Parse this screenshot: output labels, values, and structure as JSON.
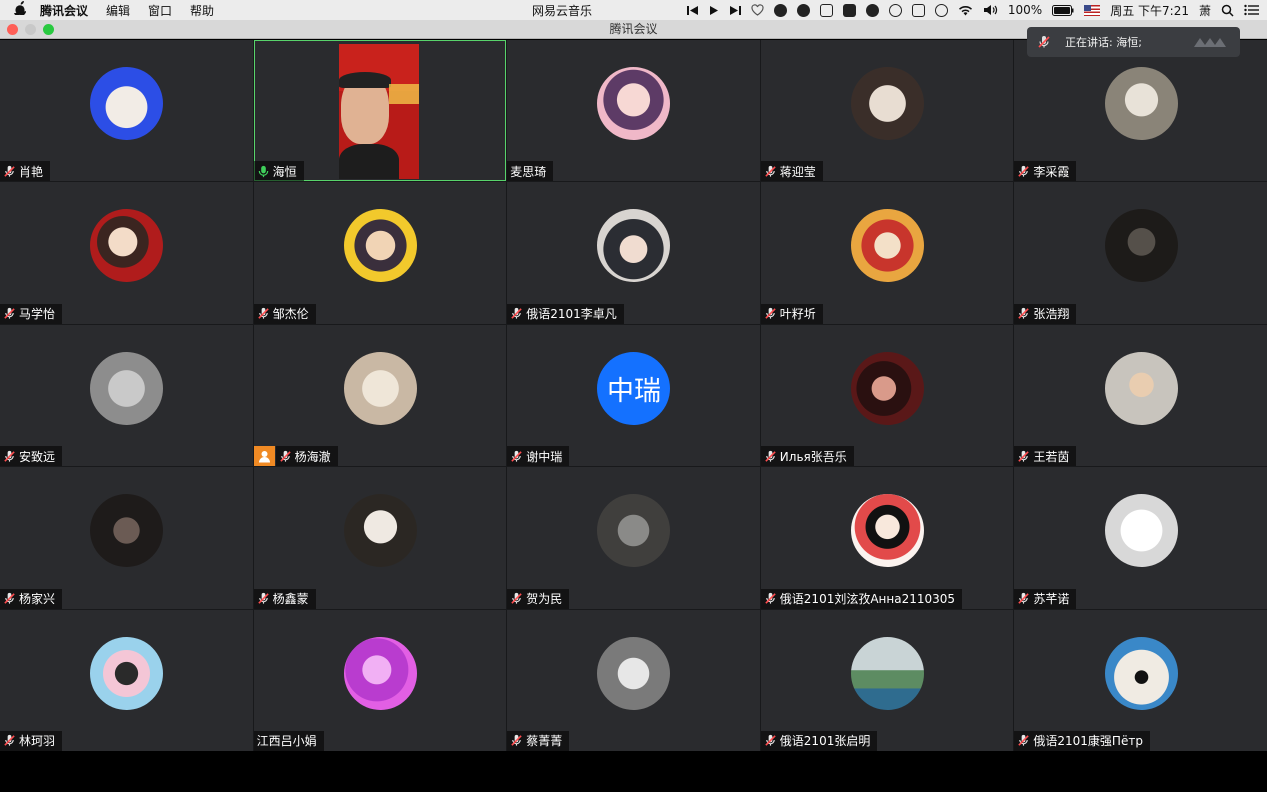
{
  "menubar": {
    "app_name": "腾讯会议",
    "menus": [
      "编辑",
      "窗口",
      "帮助"
    ],
    "now_playing": "网易云音乐",
    "battery": "100%",
    "clock": "周五 下午7:21",
    "input_method": "萧"
  },
  "window": {
    "title": "腾讯会议"
  },
  "toast": {
    "text": "正在讲话: 海恒;"
  },
  "colors": {
    "active_speaker_border": "#58d36b",
    "muted_mic": "#ff4d4f",
    "active_mic": "#3fcf5a",
    "host_badge": "#f08a24",
    "text_avatar": "#1471ff"
  },
  "participants": [
    {
      "name": "肖艳",
      "mic": "muted",
      "avatar": "lamb"
    },
    {
      "name": "海恒",
      "mic": "active",
      "avatar": "video",
      "active": true
    },
    {
      "name": "麦思琦",
      "mic": "none",
      "avatar": "anime-girl"
    },
    {
      "name": "蒋迎莹",
      "mic": "muted",
      "avatar": "cat"
    },
    {
      "name": "李采霞",
      "mic": "muted",
      "avatar": "photo"
    },
    {
      "name": "马学怡",
      "mic": "muted",
      "avatar": "illustration"
    },
    {
      "name": "邹杰伦",
      "mic": "muted",
      "avatar": "anime-boy"
    },
    {
      "name": "俄语2101李卓凡",
      "mic": "muted",
      "avatar": "girl-hat"
    },
    {
      "name": "叶籽圻",
      "mic": "muted",
      "avatar": "anime-red"
    },
    {
      "name": "张浩翔",
      "mic": "muted",
      "avatar": "dark-photo"
    },
    {
      "name": "安致远",
      "mic": "muted",
      "avatar": "hood"
    },
    {
      "name": "杨海澈",
      "mic": "muted",
      "avatar": "sketch",
      "host": true
    },
    {
      "name": "谢中瑞",
      "mic": "muted",
      "avatar": "text",
      "avatar_text": "中瑞"
    },
    {
      "name": "Илья张吾乐",
      "mic": "muted",
      "avatar": "portrait"
    },
    {
      "name": "王若茵",
      "mic": "muted",
      "avatar": "child"
    },
    {
      "name": "杨家兴",
      "mic": "muted",
      "avatar": "dark-face"
    },
    {
      "name": "杨鑫蒙",
      "mic": "muted",
      "avatar": "cat-white"
    },
    {
      "name": "贺为民",
      "mic": "muted",
      "avatar": "room"
    },
    {
      "name": "俄语2101刘泫孜Анна2110305",
      "mic": "muted",
      "avatar": "cartoon-girl"
    },
    {
      "name": "苏芊诺",
      "mic": "muted",
      "avatar": "manga"
    },
    {
      "name": "林珂羽",
      "mic": "muted",
      "avatar": "chibi"
    },
    {
      "name": "江西吕小娟",
      "mic": "none",
      "avatar": "pink-photo"
    },
    {
      "name": "蔡菁菁",
      "mic": "muted",
      "avatar": "grey-anime"
    },
    {
      "name": "俄语2101张启明",
      "mic": "muted",
      "avatar": "scenery"
    },
    {
      "name": "俄语2101康强Пётр",
      "mic": "muted",
      "avatar": "clay-figure"
    }
  ]
}
